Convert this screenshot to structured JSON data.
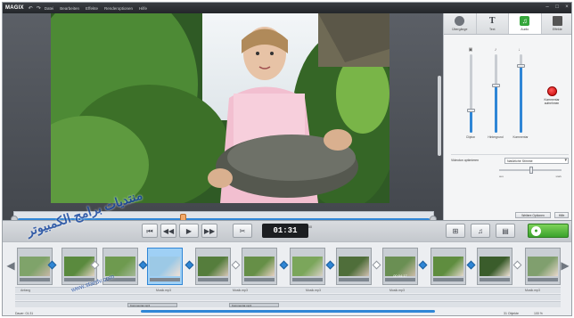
{
  "app": {
    "logo": "MAGIX"
  },
  "menu": [
    "Datei",
    "Bearbeiten",
    "Effekte",
    "Renderoptionen",
    "Hilfe"
  ],
  "tabs": [
    {
      "label": "Übergänge",
      "icon": "disc-icon"
    },
    {
      "label": "Text",
      "icon": "text-icon"
    },
    {
      "label": "Audio",
      "icon": "audio-icon"
    },
    {
      "label": "Effekte",
      "icon": "effects-icon"
    }
  ],
  "sliders": [
    {
      "label": "Clipton",
      "level": 0.28
    },
    {
      "label": "Hintergrund",
      "level": 0.6
    },
    {
      "label": "Kommentar",
      "level": 0.85
    }
  ],
  "record": {
    "label_1": "Kommentar",
    "label_2": "aufnehmen"
  },
  "options": {
    "label": "Videoton optimieren",
    "value": "Natürliche Stimme",
    "mini_left": "aus",
    "mini_right": "stark"
  },
  "advanced": {
    "label": "Weitere Optionen",
    "label2": "Hilfe"
  },
  "transport": {
    "timecode": "01:31",
    "timecode_sub": "00"
  },
  "timeline": {
    "clip_timecode": "00:04:17",
    "track_label_left": "Anfang",
    "track_labels": [
      "Musik.mp3",
      "Musik.mp3",
      "Musik.mp3",
      "Musik.mp3",
      "Musik.mp3"
    ],
    "audio_clips": [
      "Kommentar.mp3",
      "Kommentar.mp3"
    ],
    "status_left": "Dauer: 01:31",
    "status_right": "31 Objekte",
    "status_end": "100 %"
  },
  "watermark": {
    "text": "منتديات برامج الكمبيوتر",
    "url": "www.stardv.com"
  },
  "colors": {
    "accent": "#2f86d6",
    "export_green": "#3aa22b",
    "record_red": "#c40000"
  }
}
